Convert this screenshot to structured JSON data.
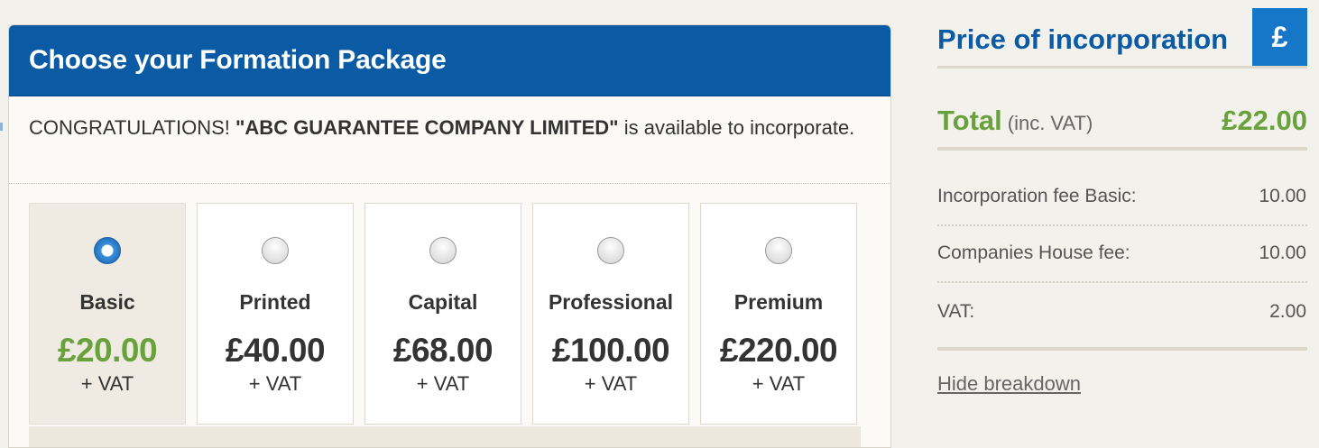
{
  "formation": {
    "title": "Choose your Formation Package",
    "congrats_prefix": "CONGRATULATIONS! ",
    "company_name": "\"ABC GUARANTEE COMPANY LIMITED\"",
    "congrats_suffix": " is available to incorporate.",
    "packages": [
      {
        "name": "Basic",
        "price": "£20.00",
        "vat": "+ VAT",
        "selected": true
      },
      {
        "name": "Printed",
        "price": "£40.00",
        "vat": "+ VAT",
        "selected": false
      },
      {
        "name": "Capital",
        "price": "£68.00",
        "vat": "+ VAT",
        "selected": false
      },
      {
        "name": "Professional",
        "price": "£100.00",
        "vat": "+ VAT",
        "selected": false
      },
      {
        "name": "Premium",
        "price": "£220.00",
        "vat": "+ VAT",
        "selected": false
      }
    ]
  },
  "price_panel": {
    "title": "Price of incorporation",
    "icon": "£",
    "total_label": "Total",
    "total_sub": "(inc. VAT)",
    "total_value": "£22.00",
    "breakdown": [
      {
        "label": "Incorporation fee Basic:",
        "value": "10.00"
      },
      {
        "label": "Companies House fee:",
        "value": "10.00"
      },
      {
        "label": "VAT:",
        "value": "2.00"
      }
    ],
    "hide_link": "Hide breakdown"
  },
  "colors": {
    "header_blue": "#0a5aa4",
    "accent_green": "#69a23d",
    "icon_blue": "#1676c7"
  }
}
